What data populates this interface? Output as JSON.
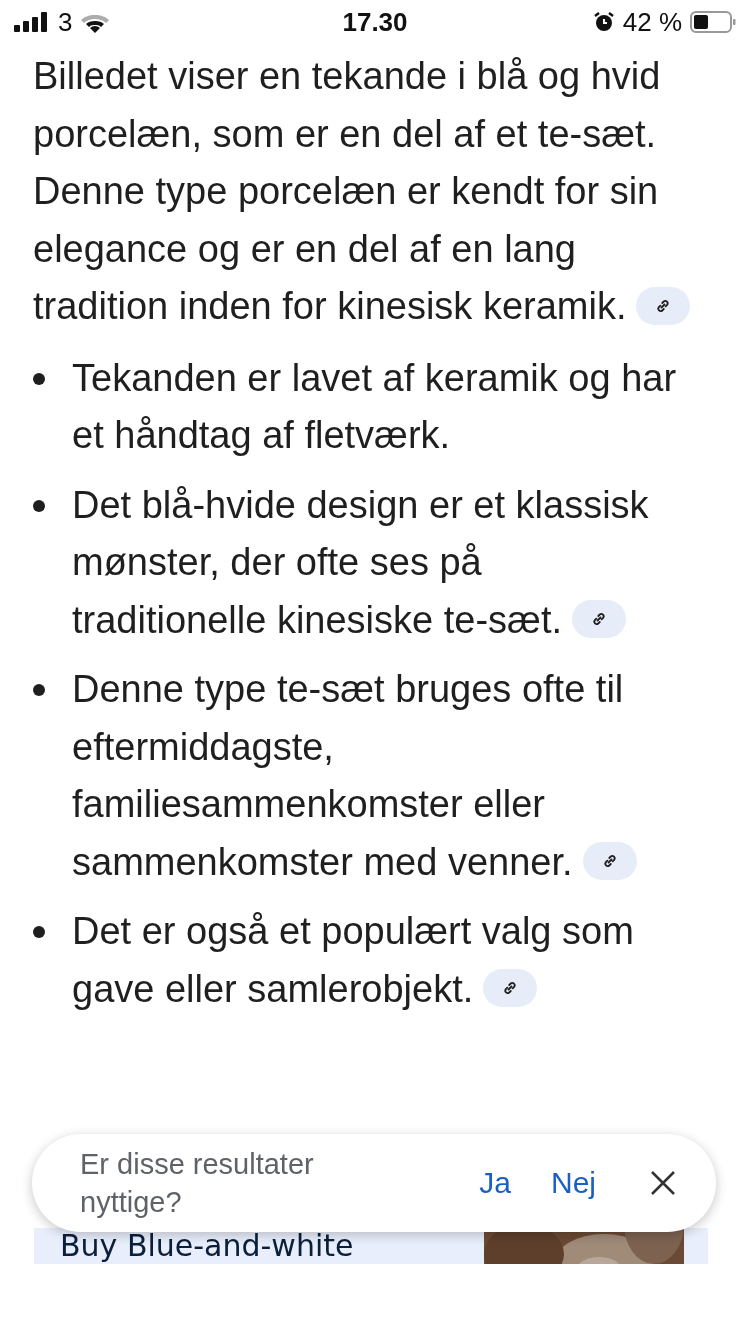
{
  "status_bar": {
    "carrier": "3",
    "time": "17.30",
    "battery_percent": "42 %"
  },
  "answer": {
    "intro": "Billedet viser en tekande i blå og hvid porcelæn, som er en del af et te-sæt. Denne type porcelæn er kendt for sin elegance og er en del af en lang tradition inden for kinesisk keramik.",
    "intro_has_source": true,
    "bullets": [
      {
        "text": "Tekanden er lavet af keramik og har et håndtag af fletværk.",
        "has_source": false
      },
      {
        "text": "Det blå-hvide design er et klassisk mønster, der ofte ses på traditionelle kinesiske te-sæt.",
        "has_source": true
      },
      {
        "text": "Denne type te-sæt bruges ofte til eftermiddagste, familiesammenkomster eller sammenkomster med venner.",
        "has_source": true
      },
      {
        "text": "Det er også et populært valg som gave eller samlerobjekt.",
        "has_source": true
      }
    ]
  },
  "result_card": {
    "title": "Buy Blue-and-white"
  },
  "feedback": {
    "question": "Er disse resultater nyttige?",
    "yes": "Ja",
    "no": "Nej"
  }
}
